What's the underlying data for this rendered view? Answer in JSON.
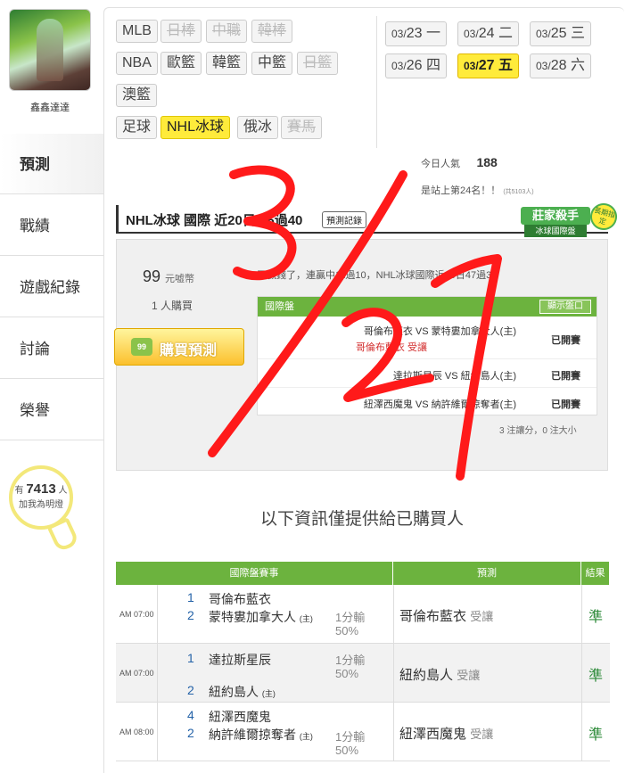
{
  "user": {
    "name": "鑫鑫達達"
  },
  "nav": [
    {
      "label": "預測"
    },
    {
      "label": "戰績"
    },
    {
      "label": "遊戲紀錄"
    },
    {
      "label": "討論"
    },
    {
      "label": "榮譽"
    }
  ],
  "lamp": {
    "prefix": "有",
    "count": "7413",
    "suffix": "人",
    "text": "加我為明燈"
  },
  "leagues": {
    "row1": [
      "MLB",
      "日棒",
      "中職",
      "韓棒"
    ],
    "row2": [
      "NBA",
      "歐籃",
      "韓籃",
      "中籃",
      "日籃"
    ],
    "row3": [
      "澳籃"
    ],
    "row4": [
      "足球",
      "NHL冰球",
      "俄冰",
      "賽馬"
    ]
  },
  "dates": [
    {
      "md": "03/",
      "d": "23",
      "w": "一"
    },
    {
      "md": "03/",
      "d": "24",
      "w": "二"
    },
    {
      "md": "03/",
      "d": "25",
      "w": "三"
    },
    {
      "md": "03/",
      "d": "26",
      "w": "四"
    },
    {
      "md": "03/",
      "d": "27",
      "w": "五"
    },
    {
      "md": "03/",
      "d": "28",
      "w": "六"
    }
  ],
  "popularity": {
    "label": "今日人氣",
    "value": "188",
    "rank_text": "是站上第24名！！",
    "rank_note": "(共5103人)"
  },
  "section": {
    "title": "NHL冰球 國際 近20日 16過40",
    "history_btn": "預測記錄"
  },
  "badge": {
    "main": "莊家殺手",
    "sub": "冰球國際盤",
    "seal": "長期指定"
  },
  "offer": {
    "price": "99",
    "unit": "元嘘幣",
    "buyers": "1 人購買",
    "buy_label": "購買預測",
    "buy_icon": "99",
    "desc": "又贏錢了，連贏中11過10，NHL冰球國際近20日47過37",
    "inner_head": "國際盤",
    "show_btn": "顯示盤口",
    "rows": [
      {
        "teams": "哥倫布藍衣 VS 蒙特婁加拿大人(主)",
        "extra": "哥倫布藍衣 受讓",
        "status": "已開賽"
      },
      {
        "teams": "達拉斯星辰 VS 紐約島人(主)",
        "status": "已開賽"
      },
      {
        "teams": "紐澤西魔鬼 VS 納許維爾掠奪者(主)",
        "status": "已開賽"
      }
    ],
    "foot": "3 注讓分，0 注大小"
  },
  "notice": "以下資訊僅提供給已購買人",
  "table": {
    "headers": [
      "國際盤賽事",
      "預測",
      "結果"
    ],
    "rows": [
      {
        "time": "AM 07:00",
        "n1": "1",
        "t1": "哥倫布藍衣",
        "n2": "2",
        "t2": "蒙特婁加拿大人",
        "home": "(主)",
        "line1": "1分輸",
        "line2": "50%",
        "pred_team": "哥倫布藍衣",
        "pred_type": "受讓",
        "result": "準"
      },
      {
        "time": "AM 07:00",
        "n1": "1",
        "t1": "達拉斯星辰",
        "n2": "2",
        "t2": "紐約島人",
        "home": "(主)",
        "line1": "1分輸",
        "line2": "50%",
        "pred_team": "紐約島人",
        "pred_type": "受讓",
        "result": "準"
      },
      {
        "time": "AM 08:00",
        "n1": "4",
        "t1": "紐澤西魔鬼",
        "n2": "2",
        "t2": "納許維爾掠奪者",
        "home": "(主)",
        "line1": "1分輸",
        "line2": "50%",
        "pred_team": "紐澤西魔鬼",
        "pred_type": "受讓",
        "result": "準"
      }
    ]
  },
  "annotation": {
    "text": "3/27",
    "color": "#ff1a1a"
  }
}
